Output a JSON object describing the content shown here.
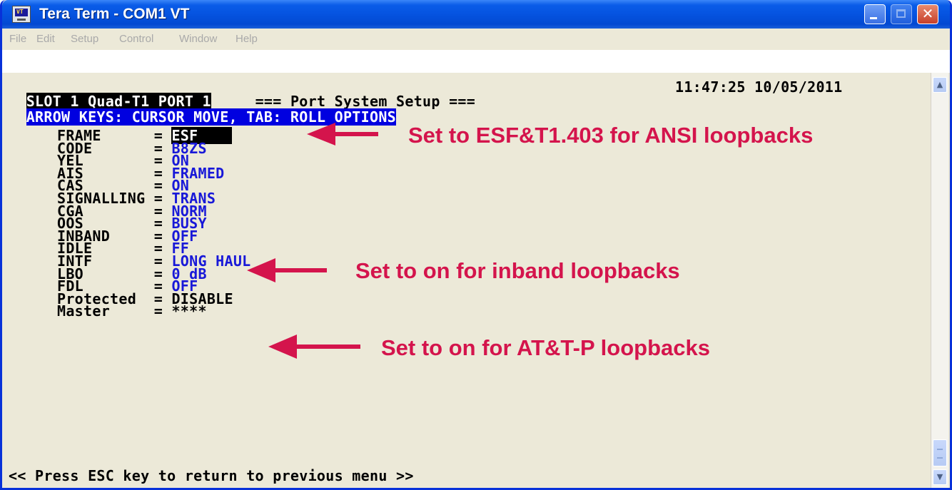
{
  "window": {
    "title": "Tera Term - COM1 VT",
    "icon": "terminal-app-icon",
    "close_glyph": "✕"
  },
  "menu": [
    "File",
    "Edit",
    "Setup",
    "Control",
    "Window",
    "Help"
  ],
  "terminal": {
    "header_slot": "SLOT 1 Quad-T1 PORT 1",
    "header_title": "=== Port System Setup ===",
    "header_datetime": "11:47:25 10/05/2011",
    "header_hint": "ARROW KEYS: CURSOR MOVE, TAB: ROLL OPTIONS",
    "settings": [
      {
        "label": "FRAME     ",
        "eq": "= ",
        "value": "ESF"
      },
      {
        "label": "CODE      ",
        "eq": "= ",
        "value": "B8ZS"
      },
      {
        "label": "YEL       ",
        "eq": "= ",
        "value": "ON"
      },
      {
        "label": "AIS       ",
        "eq": "= ",
        "value": "FRAMED"
      },
      {
        "label": "CAS       ",
        "eq": "= ",
        "value": "ON"
      },
      {
        "label": "SIGNALLING",
        "eq": "= ",
        "value": "TRANS"
      },
      {
        "label": "CGA       ",
        "eq": "= ",
        "value": "NORM"
      },
      {
        "label": "OOS       ",
        "eq": "= ",
        "value": "BUSY"
      },
      {
        "label": "INBAND    ",
        "eq": "= ",
        "value": "OFF"
      },
      {
        "label": "IDLE      ",
        "eq": "= ",
        "value": "FF"
      },
      {
        "label": "INTF      ",
        "eq": "= ",
        "value": "LONG HAUL"
      },
      {
        "label": "LBO       ",
        "eq": "= ",
        "value": "0 dB"
      },
      {
        "label": "FDL       ",
        "eq": "= ",
        "value": "OFF"
      },
      {
        "label": "Protected ",
        "eq": "= ",
        "value": "DISABLE"
      },
      {
        "label": "Master    ",
        "eq": "= ",
        "value": "****"
      }
    ],
    "footer": "<< Press ESC key to return to previous menu >>"
  },
  "annotations": {
    "frame_note": "Set to ESF&T1.403 for ANSI loopbacks",
    "inband_note": "Set to on for inband loopbacks",
    "fdl_note": "Set to on for AT&T-P loopbacks",
    "color": "#d4144c"
  },
  "scrollbar": {
    "up_glyph": "▲",
    "down_glyph": "▼"
  }
}
